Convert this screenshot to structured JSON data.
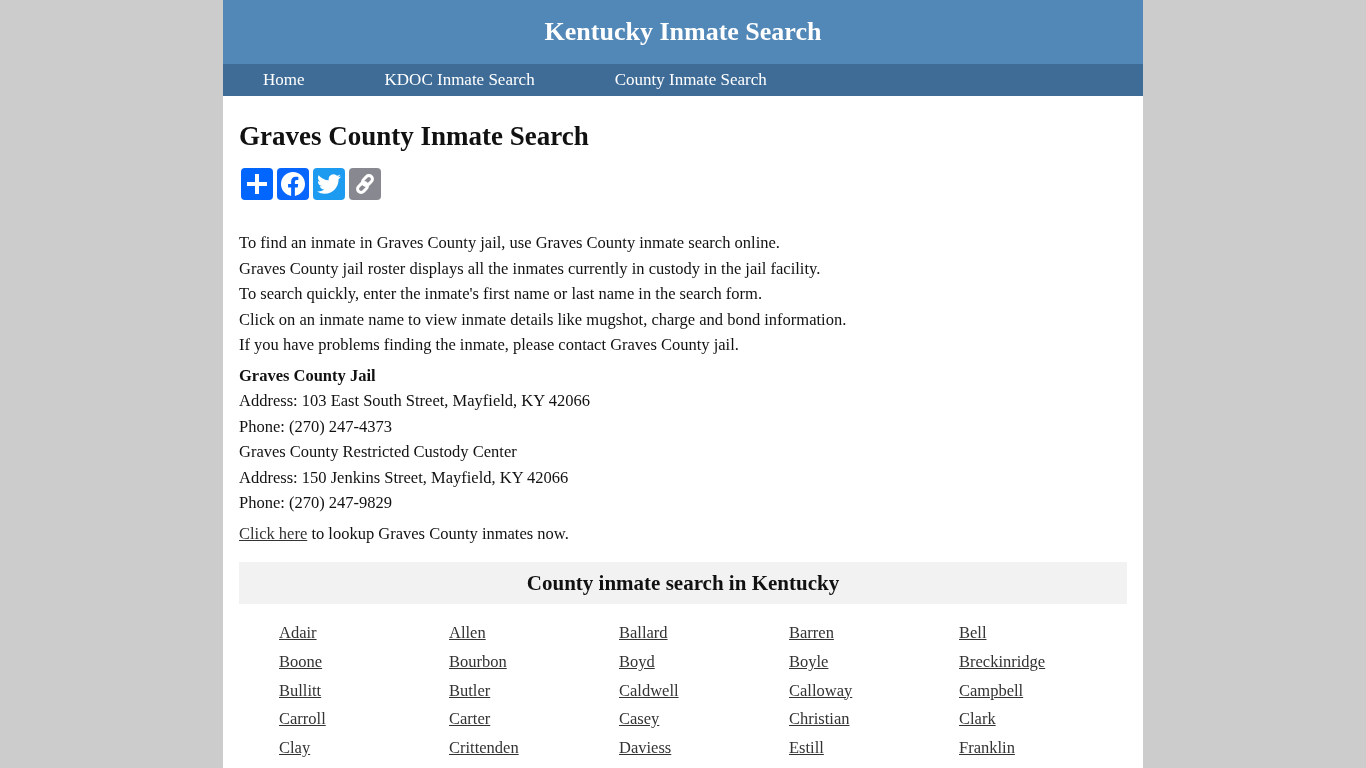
{
  "header": {
    "title": "Kentucky Inmate Search"
  },
  "nav": [
    {
      "label": "Home"
    },
    {
      "label": "KDOC Inmate Search"
    },
    {
      "label": "County Inmate Search"
    }
  ],
  "page_title": "Graves County Inmate Search",
  "intro_lines": [
    "To find an inmate in Graves County jail, use Graves County inmate search online.",
    "Graves County jail roster displays all the inmates currently in custody in the jail facility.",
    "To search quickly, enter the inmate's first name or last name in the search form.",
    "Click on an inmate name to view inmate details like mugshot, charge and bond information.",
    "If you have problems finding the inmate, please contact Graves County jail."
  ],
  "facility": {
    "name": "Graves County Jail",
    "lines": [
      "Address: 103 East South Street, Mayfield, KY 42066",
      "Phone: (270) 247-4373",
      "Graves County Restricted Custody Center",
      "Address: 150 Jenkins Street, Mayfield, KY 42066",
      "Phone: (270) 247-9829"
    ]
  },
  "lookup": {
    "link": "Click here",
    "text": "to lookup Graves County inmates now."
  },
  "county_section": {
    "title": "County inmate search in Kentucky",
    "counties": [
      "Adair",
      "Allen",
      "Ballard",
      "Barren",
      "Bell",
      "Boone",
      "Bourbon",
      "Boyd",
      "Boyle",
      "Breckinridge",
      "Bullitt",
      "Butler",
      "Caldwell",
      "Calloway",
      "Campbell",
      "Carroll",
      "Carter",
      "Casey",
      "Christian",
      "Clark",
      "Clay",
      "Crittenden",
      "Daviess",
      "Estill",
      "Franklin"
    ]
  }
}
